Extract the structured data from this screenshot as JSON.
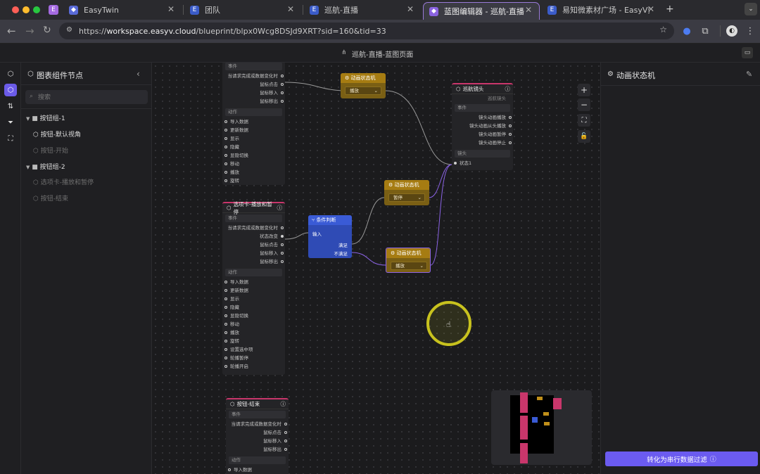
{
  "browser": {
    "tabs": [
      {
        "label": "EasyTwin"
      },
      {
        "label": "团队"
      },
      {
        "label": "巡航-直播"
      },
      {
        "label": "蓝图编辑器 - 巡航-直播"
      },
      {
        "label": "易知微素材广场 - EasyV数字孪"
      }
    ],
    "new_tab": "+",
    "url": {
      "scheme": "https://",
      "host": "workspace.easyv.cloud",
      "path": "/blueprint/blpx0Wcg8DSJd9XRT?sid=160&tid=33"
    }
  },
  "app": {
    "page_title": "巡航-直播-蓝图页面"
  },
  "left_panel": {
    "title": "图表组件节点",
    "search_placeholder": "搜索",
    "tree": [
      {
        "label": "按钮组-1",
        "type": "group"
      },
      {
        "label": "按钮-默认视角",
        "type": "item"
      },
      {
        "label": "按钮-开始",
        "type": "item",
        "dim": true
      },
      {
        "label": "按钮组-2",
        "type": "group"
      },
      {
        "label": "选项卡-播放和暂停",
        "type": "item",
        "dim": true
      },
      {
        "label": "按钮-结束",
        "type": "item",
        "dim": true
      }
    ]
  },
  "canvas": {
    "node_top": {
      "event_title": "事件",
      "events": [
        "当请求完成或数据变化时",
        "鼠标点击",
        "鼠标移入",
        "鼠标移出"
      ],
      "action_title": "动作",
      "actions": [
        "导入数据",
        "更新数据",
        "显示",
        "隐藏",
        "显隐切换",
        "移动",
        "播放",
        "旋转"
      ]
    },
    "node_tab": {
      "title": "选项卡-播放和暂停",
      "event_title": "事件",
      "events": [
        "当请求完成或数据变化时",
        "状态改变",
        "鼠标点击",
        "鼠标移入",
        "鼠标移出"
      ],
      "action_title": "动作",
      "actions": [
        "导入数据",
        "更新数据",
        "显示",
        "隐藏",
        "显隐切换",
        "移动",
        "播放",
        "旋转",
        "设置选中项",
        "轮播暂停",
        "轮播开启"
      ]
    },
    "node_end": {
      "title": "按钮-结束",
      "event_title": "事件",
      "events": [
        "当请求完成或数据变化时",
        "鼠标点击",
        "鼠标移入",
        "鼠标移出"
      ],
      "action_title": "动作",
      "actions": [
        "导入数据"
      ]
    },
    "anim1": {
      "title": "动画状态机",
      "value": "播放"
    },
    "anim2": {
      "title": "动画状态机",
      "value": "暂停"
    },
    "anim3": {
      "title": "动画状态机",
      "value": "播放"
    },
    "branch": {
      "title": "条件判断",
      "input": "输入",
      "yes": "满足",
      "no": "不满足"
    },
    "camera": {
      "title": "巡航镜头",
      "subtitle": "巡航镜头",
      "event_title": "事件",
      "events": [
        "镜头动画播放",
        "镜头动画从头播放",
        "镜头动画暂停",
        "镜头动画停止"
      ],
      "lens_title": "镜头",
      "lens_port": "状态1"
    },
    "zoom_buttons": [
      "+",
      "−",
      "⛶",
      "🔓"
    ]
  },
  "right_panel": {
    "title": "动画状态机",
    "convert_button": "转化为串行数据过滤"
  },
  "colors": {
    "accent": "#6b5bf0",
    "anim_node": "#a67c12",
    "branch_node": "#3653c9",
    "wire_purple": "#8b63e6"
  }
}
